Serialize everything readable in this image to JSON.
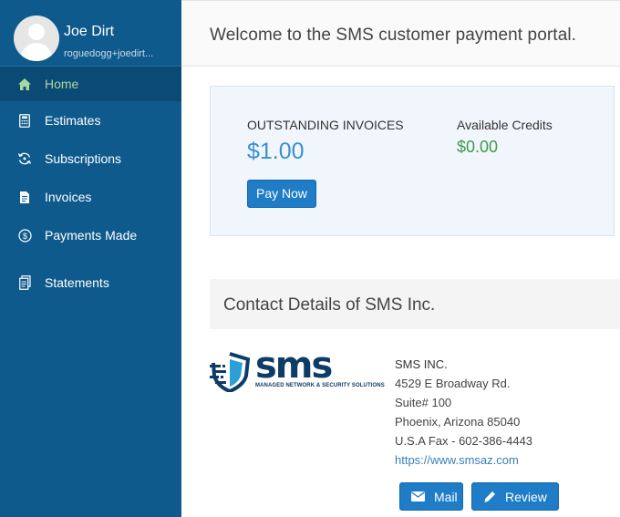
{
  "user": {
    "name": "Joe Dirt",
    "email": "roguedogg+joedirt...",
    "avatar_icon": "user-avatar-icon"
  },
  "sidebar": {
    "items": [
      {
        "label": "Home",
        "icon": "home-icon",
        "active": true
      },
      {
        "label": "Estimates",
        "icon": "calculator-icon"
      },
      {
        "label": "Subscriptions",
        "icon": "recurring-icon"
      },
      {
        "label": "Invoices",
        "icon": "document-icon"
      },
      {
        "label": "Payments Made",
        "icon": "dollar-circle-icon"
      },
      {
        "label": "Statements",
        "icon": "statement-icon"
      }
    ]
  },
  "header": {
    "welcome": "Welcome to the SMS customer payment portal."
  },
  "summary": {
    "outstanding_label": "OUTSTANDING INVOICES",
    "outstanding_amount": "$1.00",
    "credits_label": "Available Credits",
    "credits_amount": "$0.00",
    "pay_now_label": "Pay Now"
  },
  "contact": {
    "title": "Contact Details of SMS Inc.",
    "logo_text": "sms",
    "logo_tagline": "MANAGED NETWORK & SECURITY SOLUTIONS",
    "company": "SMS INC.",
    "address_line1": "4529 E Broadway Rd.",
    "address_line2": "Suite# 100",
    "address_line3": "Phoenix, Arizona 85040",
    "fax": "U.S.A Fax - 602-386-4443",
    "website": "https://www.smsaz.com",
    "mail_label": "Mail",
    "review_label": "Review"
  },
  "colors": {
    "sidebar": "#0f5a8c",
    "sidebar_active": "#0b4a75",
    "active_text": "#a8d8a0",
    "accent_blue": "#1f7cc6",
    "credits_green": "#3f9a4a"
  }
}
